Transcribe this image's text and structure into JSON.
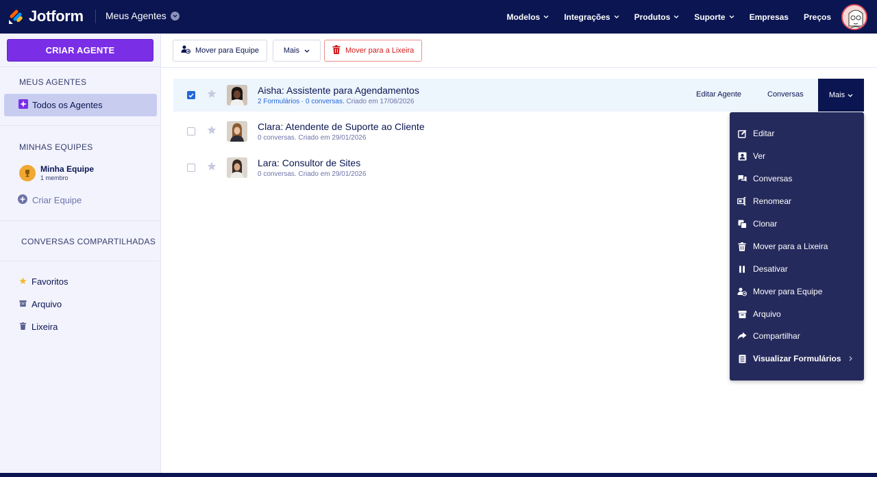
{
  "app": {
    "logo_text": "Jotform",
    "section_title": "Meus Agentes"
  },
  "nav": {
    "links": [
      {
        "label": "Modelos",
        "has_caret": true
      },
      {
        "label": "Integrações",
        "has_caret": true
      },
      {
        "label": "Produtos",
        "has_caret": true
      },
      {
        "label": "Suporte",
        "has_caret": true
      },
      {
        "label": "Empresas",
        "has_caret": false
      },
      {
        "label": "Preços",
        "has_caret": false
      }
    ]
  },
  "sidebar": {
    "create_label": "CRIAR AGENTE",
    "my_agents_heading": "MEUS AGENTES",
    "all_agents_label": "Todos os Agentes",
    "my_teams_heading": "MINHAS EQUIPES",
    "team_name": "Minha Equipe",
    "team_members": "1 membro",
    "create_team_label": "Criar Equipe",
    "shared_heading": "CONVERSAS COMPARTILHADAS",
    "favorites_label": "Favoritos",
    "archive_label": "Arquivo",
    "trash_label": "Lixeira"
  },
  "toolbar": {
    "move_team_label": "Mover para Equipe",
    "more_label": "Mais",
    "trash_label": "Mover para a Lixeira"
  },
  "agents": [
    {
      "title": "Aisha: Assistente para Agendamentos",
      "forms_link": "2 Formulários",
      "sep": " · ",
      "conversations_link": "0 conversas.",
      "created": " Criado em 17/08/2026",
      "selected": true
    },
    {
      "title": "Clara: Atendente de Suporte ao Cliente",
      "subtitle": "0 conversas. Criado em 29/01/2026",
      "selected": false
    },
    {
      "title": "Lara: Consultor de Sites",
      "subtitle": "0 conversas. Criado em 29/01/2026",
      "selected": false
    }
  ],
  "row_actions": {
    "edit_label": "Editar Agente",
    "conversations_label": "Conversas",
    "more_label": "Mais"
  },
  "menu": {
    "items": [
      {
        "label": "Editar",
        "icon": "edit-icon"
      },
      {
        "label": "Ver",
        "icon": "view-icon"
      },
      {
        "label": "Conversas",
        "icon": "chat-icon"
      },
      {
        "label": "Renomear",
        "icon": "rename-icon"
      },
      {
        "label": "Clonar",
        "icon": "clone-icon"
      },
      {
        "label": "Mover para a Lixeira",
        "icon": "trash-icon"
      },
      {
        "label": "Desativar",
        "icon": "pause-icon"
      },
      {
        "label": "Mover para Equipe",
        "icon": "team-move-icon"
      },
      {
        "label": "Arquivo",
        "icon": "archive-icon"
      },
      {
        "label": "Compartilhar",
        "icon": "share-icon"
      },
      {
        "label": "Visualizar Formulários",
        "icon": "form-icon"
      }
    ]
  },
  "colors": {
    "navy": "#0a1551",
    "purple": "#7a2ee6",
    "menu_bg": "#252a5c",
    "link_blue": "#2466d6",
    "danger": "#d11b1b"
  }
}
